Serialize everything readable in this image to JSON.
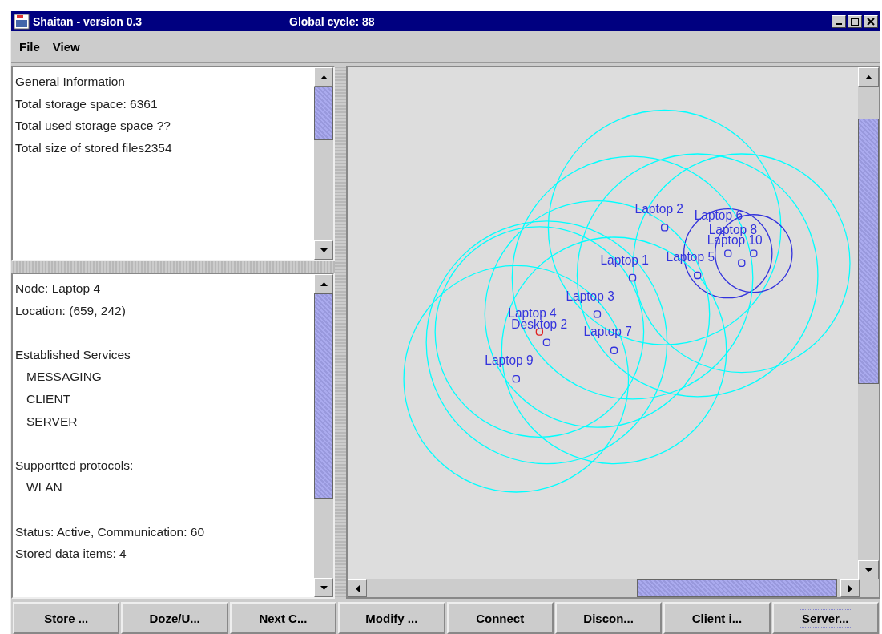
{
  "window": {
    "title": "Shaitan - version 0.3",
    "status": "Global cycle: 88"
  },
  "menu": [
    "File",
    "View"
  ],
  "info_panel": {
    "groups": [
      [
        {
          "text": "General Information"
        },
        {
          "text": "Total storage space: 6361"
        },
        {
          "text": "Total used storage space ??"
        },
        {
          "text": "Total size of stored files2354"
        }
      ]
    ]
  },
  "node_panel": {
    "groups": [
      [
        {
          "text": "Node: Laptop 4"
        },
        {
          "text": "Location: (659, 242)"
        }
      ],
      [
        {
          "text": "Established Services",
          "children": [
            "MESSAGING",
            "CLIENT",
            "SERVER"
          ]
        }
      ],
      [
        {
          "text": "Supportted protocols:",
          "children": [
            "WLAN"
          ]
        }
      ],
      [
        {
          "text": "Status: Active, Communication: 60"
        },
        {
          "text": "Stored data items: 4"
        }
      ]
    ]
  },
  "network": {
    "nodes": [
      {
        "label": "Laptop 2",
        "selected": false,
        "kind": "long_range"
      },
      {
        "label": "Laptop 6",
        "selected": false,
        "kind": "short_range"
      },
      {
        "label": "Laptop 8",
        "selected": false,
        "kind": "short_range"
      },
      {
        "label": "Laptop 10",
        "selected": false,
        "kind": "long_range"
      },
      {
        "label": "Laptop 5",
        "selected": false,
        "kind": "long_range"
      },
      {
        "label": "Laptop 1",
        "selected": false,
        "kind": "long_range"
      },
      {
        "label": "Laptop 3",
        "selected": false,
        "kind": "long_range"
      },
      {
        "label": "Laptop 4",
        "selected": true,
        "kind": "long_range"
      },
      {
        "label": "Desktop 2",
        "selected": false,
        "kind": "long_range"
      },
      {
        "label": "Laptop 7",
        "selected": false,
        "kind": "long_range"
      },
      {
        "label": "Laptop 9",
        "selected": false,
        "kind": "long_range"
      }
    ]
  },
  "buttons": [
    {
      "label": "Store ...",
      "focused": false
    },
    {
      "label": "Doze/U...",
      "focused": false
    },
    {
      "label": "Next C...",
      "focused": false
    },
    {
      "label": "Modify ...",
      "focused": false
    },
    {
      "label": "Connect",
      "focused": false
    },
    {
      "label": "Discon...",
      "focused": false
    },
    {
      "label": "Client i...",
      "focused": false
    },
    {
      "label": "Server...",
      "focused": true
    }
  ]
}
